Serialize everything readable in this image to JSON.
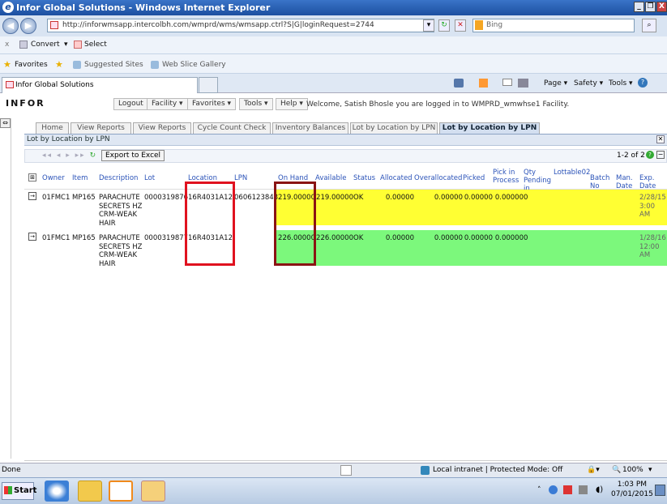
{
  "window": {
    "title": "Infor Global Solutions - Windows Internet Explorer",
    "minimize": "_",
    "restore": "❐",
    "close": "X"
  },
  "address": {
    "url": "http://inforwmsapp.intercolbh.com/wmprd/wms/wmsapp.ctrl?S|G|loginRequest=2744",
    "search_placeholder": "Bing"
  },
  "commandbar": {
    "close": "x",
    "convert": "Convert",
    "select": "Select"
  },
  "favorites": {
    "label": "Favorites",
    "suggested": "Suggested Sites",
    "webslice": "Web Slice Gallery"
  },
  "ie_tab": {
    "title": "Infor Global Solutions",
    "menu": [
      "Page",
      "Safety",
      "Tools"
    ]
  },
  "app": {
    "logo": "INFOR",
    "menu": [
      "Logout",
      "Facility",
      "Favorites",
      "Tools",
      "Help"
    ],
    "welcome": "Welcome, Satish Bhosle you are logged in to WMPRD_wmwhse1 Facility."
  },
  "nav_tabs": [
    "Home",
    "View Reports",
    "View Reports",
    "Cycle Count Check",
    "Inventory Balances",
    "Lot by Location by LPN",
    "Lot by Location by LPN"
  ],
  "panel": {
    "title": "Lot by Location by LPN",
    "export": "Export to Excel",
    "pager": "1-2 of 2"
  },
  "grid": {
    "columns": [
      "Owner",
      "Item",
      "Description",
      "Lot",
      "Location",
      "LPN",
      "On Hand",
      "Available",
      "Status",
      "Allocated",
      "Overallocated",
      "Picked",
      "Pick in Process",
      "Qty Pending in",
      "Lottable02",
      "Batch No",
      "Man. Date",
      "Exp. Date"
    ],
    "rows": [
      {
        "owner": "01FMC1",
        "item": "MP165",
        "description": "PARACHUTE SECRETS HZ CRM-WEAK HAIR",
        "lot": "0000319876",
        "location": "16R4031A12",
        "lpn": "0606123848",
        "onhand": "219.00000",
        "available": "219.00000",
        "status": "OK",
        "allocated": "0.00000",
        "overallocated": "0.00000",
        "picked": "0.00000",
        "pickinprocess": "0.00000",
        "qtypending": "0",
        "lottable02": "",
        "batch": "",
        "mandate": "",
        "expdate": "2/28/15 3:00 AM",
        "color": "#ffff33"
      },
      {
        "owner": "01FMC1",
        "item": "MP165",
        "description": "PARACHUTE SECRETS HZ CRM-WEAK HAIR",
        "lot": "0000319877",
        "location": "16R4031A12",
        "lpn": "",
        "onhand": "226.00000",
        "available": "226.00000",
        "status": "OK",
        "allocated": "0.00000",
        "overallocated": "0.00000",
        "picked": "0.00000",
        "pickinprocess": "0.00000",
        "qtypending": "0",
        "lottable02": "",
        "batch": "",
        "mandate": "",
        "expdate": "1/28/16 12:00 AM",
        "color": "#7cf87c"
      }
    ]
  },
  "status": {
    "left": "Done",
    "zone": "Local intranet | Protected Mode: Off",
    "zoom": "100%"
  },
  "taskbar": {
    "start": "Start",
    "time": "1:03 PM",
    "date": "07/01/2015"
  }
}
